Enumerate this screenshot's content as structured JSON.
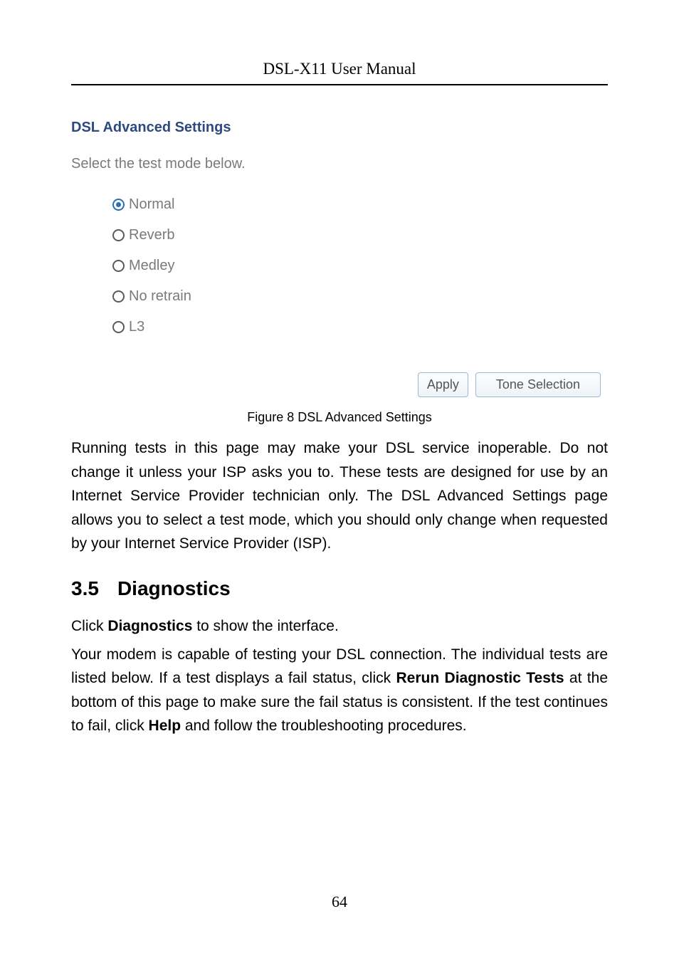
{
  "header": {
    "title": "DSL-X11 User Manual"
  },
  "settings": {
    "title": "DSL Advanced Settings",
    "prompt": "Select the test mode below.",
    "options": [
      {
        "label": "Normal",
        "selected": true
      },
      {
        "label": "Reverb",
        "selected": false
      },
      {
        "label": "Medley",
        "selected": false
      },
      {
        "label": "No retrain",
        "selected": false
      },
      {
        "label": "L3",
        "selected": false
      }
    ],
    "buttons": {
      "apply": "Apply",
      "tone": "Tone Selection"
    }
  },
  "figure": {
    "caption": "Figure 8 DSL Advanced Settings"
  },
  "para1": "Running tests in this page may make your DSL service inoperable. Do not change it unless your ISP asks you to. These tests are designed for use by an Internet Service Provider technician only. The DSL Advanced Settings page allows you to select a test mode, which you should only change when requested by your Internet Service Provider (ISP).",
  "section": {
    "num": "3.5",
    "title": "Diagnostics"
  },
  "diag": {
    "intro_pre": "Click ",
    "intro_bold": "Diagnostics",
    "intro_post": " to show the interface.",
    "p1_a": "Your modem is capable of testing your DSL connection. The individual tests are listed below. If a test displays a fail status, click ",
    "p1_b": "Rerun Diagnostic Tests",
    "p1_c": " at the bottom of this page to make sure the fail status is consistent. If the test continues to fail, click ",
    "p1_d": "Help",
    "p1_e": " and follow the troubleshooting procedures."
  },
  "footer": {
    "page": "64"
  }
}
